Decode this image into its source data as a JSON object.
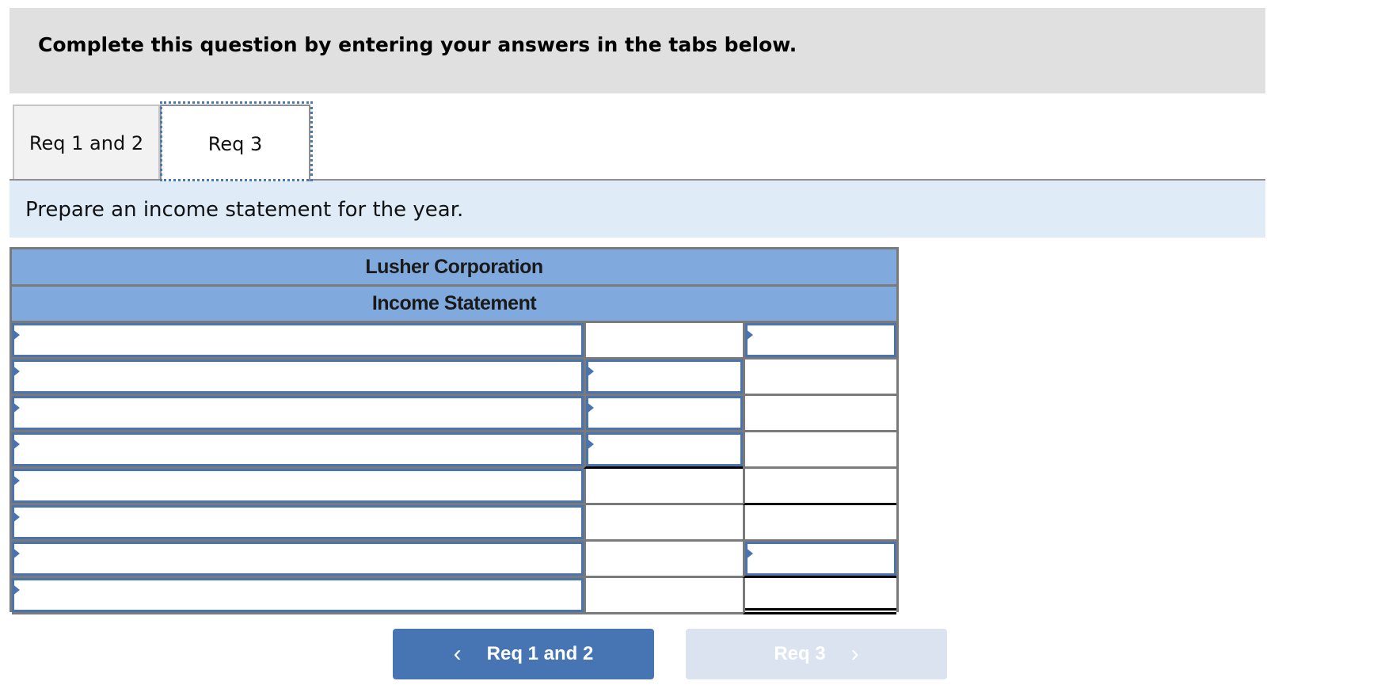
{
  "banner": {
    "text": "Complete this question by entering your answers in the tabs below."
  },
  "tabs": [
    {
      "label": "Req 1 and 2",
      "active": false
    },
    {
      "label": "Req 3",
      "active": true
    }
  ],
  "instruction": {
    "text": "Prepare an income statement for the year."
  },
  "statement": {
    "company": "Lusher Corporation",
    "title": "Income Statement",
    "rows": [
      {
        "label": "",
        "col2": "",
        "col3": ""
      },
      {
        "label": "",
        "col2": "",
        "col3": ""
      },
      {
        "label": "",
        "col2": "",
        "col3": ""
      },
      {
        "label": "",
        "col2": "",
        "col3": ""
      },
      {
        "label": "",
        "col2": "",
        "col3": ""
      },
      {
        "label": "",
        "col2": "",
        "col3": ""
      },
      {
        "label": "",
        "col2": "",
        "col3": ""
      },
      {
        "label": "",
        "col2": "",
        "col3": ""
      }
    ]
  },
  "nav": {
    "prev": {
      "label": "Req 1 and 2",
      "icon": "chevron-left-icon",
      "glyph": "‹"
    },
    "next": {
      "label": "Req 3",
      "icon": "chevron-right-icon",
      "glyph": "›",
      "disabled": true
    }
  },
  "colors": {
    "accent": "#4775b4",
    "header_blue": "#80aadd",
    "input_border": "#4a74b0",
    "instruction_bg": "#dfecf8",
    "banner_bg": "#e0e0e0",
    "disabled_btn": "#dae3ef"
  }
}
